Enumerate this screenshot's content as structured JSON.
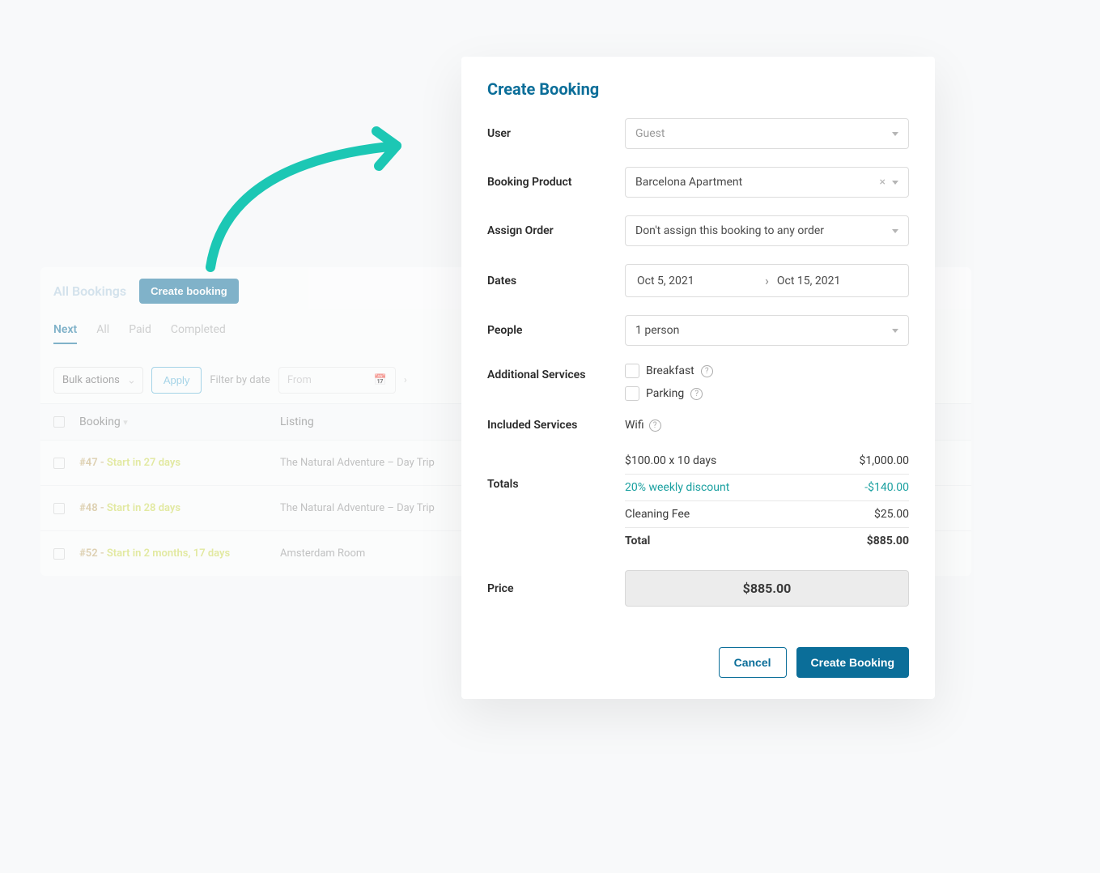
{
  "background": {
    "title": "All Bookings",
    "create_button": "Create booking",
    "tabs": [
      "Next",
      "All",
      "Paid",
      "Completed"
    ],
    "active_tab": "Next",
    "bulk_actions": "Bulk actions",
    "apply": "Apply",
    "filter_label": "Filter by date",
    "from_placeholder": "From",
    "columns": {
      "booking": "Booking",
      "listing": "Listing"
    },
    "rows": [
      {
        "id": "#47",
        "badge": "Start in 27 days",
        "listing": "The Natural Adventure – Day Trip"
      },
      {
        "id": "#48",
        "badge": "Start in 28 days",
        "listing": "The Natural Adventure – Day Trip"
      },
      {
        "id": "#52",
        "badge": "Start in 2 months, 17 days",
        "listing": "Amsterdam Room"
      }
    ]
  },
  "modal": {
    "title": "Create Booking",
    "labels": {
      "user": "User",
      "product": "Booking Product",
      "assign": "Assign Order",
      "dates": "Dates",
      "people": "People",
      "additional": "Additional Services",
      "included": "Included Services",
      "totals": "Totals",
      "price": "Price"
    },
    "fields": {
      "user": "Guest",
      "product": "Barcelona Apartment",
      "assign": "Don't assign this booking to any order",
      "date_start": "Oct 5, 2021",
      "date_end": "Oct 15, 2021",
      "people": "1 person",
      "additional": [
        "Breakfast",
        "Parking"
      ],
      "included": "Wifi"
    },
    "totals": {
      "line1_label": "$100.00 x 10 days",
      "line1_value": "$1,000.00",
      "discount_label": "20% weekly discount",
      "discount_value": "-$140.00",
      "fee_label": "Cleaning Fee",
      "fee_value": "$25.00",
      "total_label": "Total",
      "total_value": "$885.00"
    },
    "price": "$885.00",
    "footer": {
      "cancel": "Cancel",
      "create": "Create Booking"
    }
  }
}
